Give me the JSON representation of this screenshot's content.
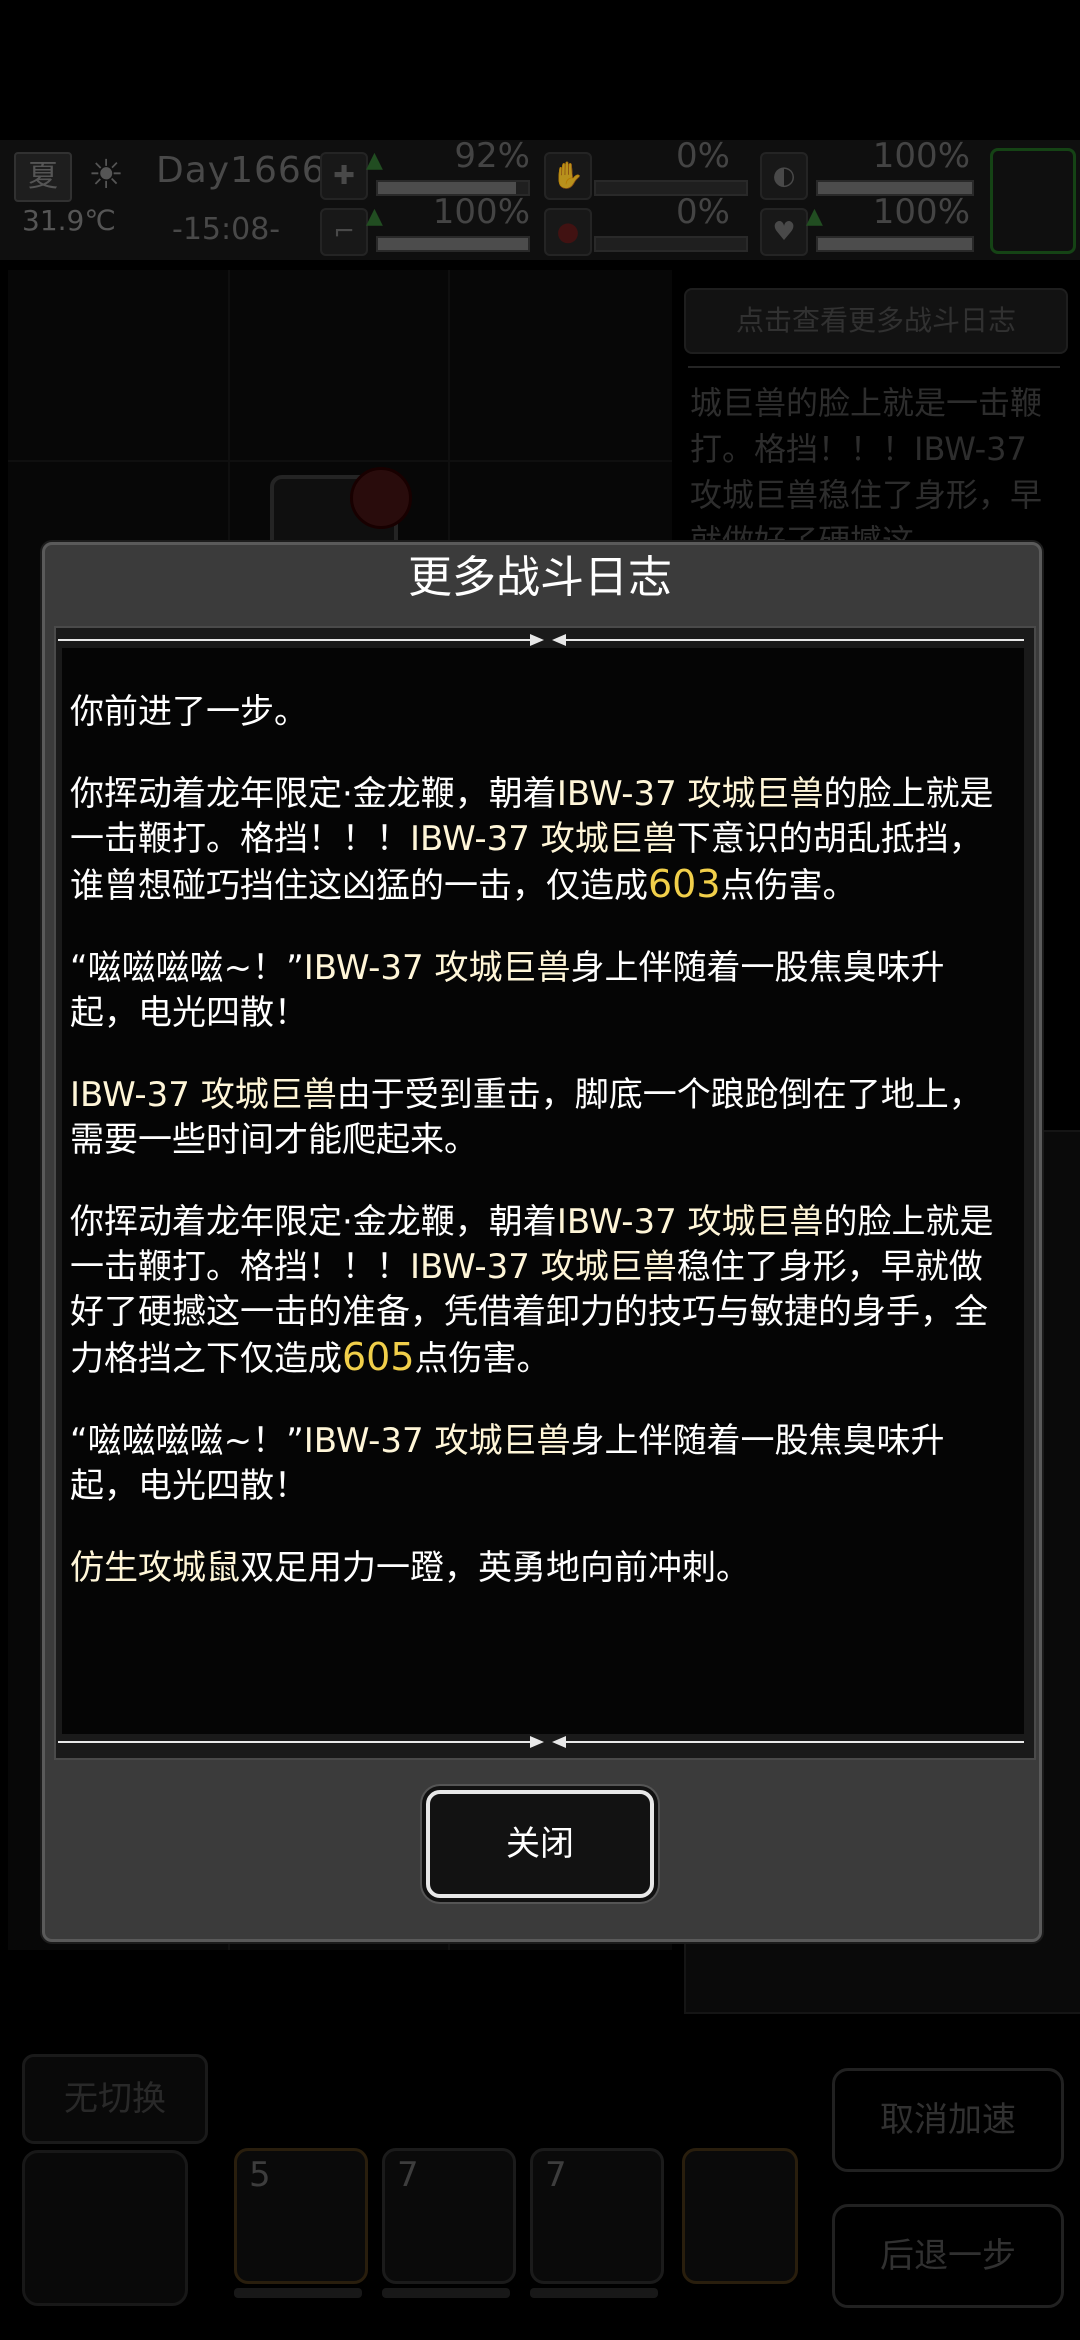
{
  "status": {
    "season": "夏",
    "temperature": "31.9℃",
    "day": "Day1666",
    "time": "-15:08-",
    "stats": [
      {
        "icon": "medkit-icon",
        "value": "92%",
        "level": 0.92
      },
      {
        "icon": "boot-icon",
        "value": "100%",
        "level": 1.0
      },
      {
        "icon": "blood-icon",
        "value": "0%",
        "level": 0.0
      },
      {
        "icon": "blood-drop-icon",
        "value": "0%",
        "level": 0.0
      },
      {
        "icon": "stomach-icon",
        "value": "100%",
        "level": 1.0
      },
      {
        "icon": "heart-icon",
        "value": "100%",
        "level": 1.0
      }
    ]
  },
  "side_log": {
    "button_label": "点击查看更多战斗日志",
    "preview": "城巨兽的脸上就是一击鞭打。格挡！！！IBW-37 攻城巨兽稳住了身形，早就做好了硬撼这"
  },
  "controls": {
    "switch_label": "无切换",
    "cancel_speed_label": "取消加速",
    "step_back_label": "后退一步",
    "skills": [
      {
        "count": "5"
      },
      {
        "count": "7"
      },
      {
        "count": "7"
      }
    ]
  },
  "dialog": {
    "title": "更多战斗日志",
    "close_label": "关闭",
    "entries": [
      {
        "parts": [
          {
            "t": "你前进了一步。",
            "s": "plain"
          }
        ]
      },
      {
        "parts": [
          {
            "t": "你挥动着龙年限定·金龙鞭，朝着",
            "s": "plain"
          },
          {
            "t": "IBW-37 攻城巨兽",
            "s": "hl"
          },
          {
            "t": "的脸上就是一击鞭打。格挡！！！",
            "s": "plain"
          },
          {
            "t": "IBW-37 攻城巨兽",
            "s": "hl"
          },
          {
            "t": "下意识的胡乱抵挡，谁曾想碰巧挡住这凶猛的一击，仅造成",
            "s": "plain"
          },
          {
            "t": "603",
            "s": "dmg"
          },
          {
            "t": "点伤害。",
            "s": "plain"
          }
        ]
      },
      {
        "parts": [
          {
            "t": "“嗞嗞嗞嗞~！”",
            "s": "plain"
          },
          {
            "t": "IBW-37 攻城巨兽",
            "s": "hl"
          },
          {
            "t": "身上伴随着一股焦臭味升起，电光四散！",
            "s": "plain"
          }
        ]
      },
      {
        "parts": [
          {
            "t": "IBW-37 攻城巨兽",
            "s": "hl"
          },
          {
            "t": "由于受到重击，脚底一个踉跄倒在了地上，需要一些时间才能爬起来。",
            "s": "plain"
          }
        ]
      },
      {
        "parts": [
          {
            "t": "你挥动着龙年限定·金龙鞭，朝着",
            "s": "plain"
          },
          {
            "t": "IBW-37 攻城巨兽",
            "s": "hl"
          },
          {
            "t": "的脸上就是一击鞭打。格挡！！！",
            "s": "plain"
          },
          {
            "t": "IBW-37 攻城巨兽",
            "s": "hl"
          },
          {
            "t": "稳住了身形，早就做好了硬撼这一击的准备，凭借着卸力的技巧与敏捷的身手，全力格挡之下仅造成",
            "s": "plain"
          },
          {
            "t": "605",
            "s": "dmg"
          },
          {
            "t": "点伤害。",
            "s": "plain"
          }
        ]
      },
      {
        "parts": [
          {
            "t": "“嗞嗞嗞嗞~！”",
            "s": "plain"
          },
          {
            "t": "IBW-37 攻城巨兽",
            "s": "hl"
          },
          {
            "t": "身上伴随着一股焦臭味升起，电光四散！",
            "s": "plain"
          }
        ]
      },
      {
        "parts": [
          {
            "t": "仿生攻城鼠",
            "s": "hl"
          },
          {
            "t": "双足用力一蹬，英勇地向前冲刺。",
            "s": "plain"
          }
        ]
      }
    ]
  },
  "colors": {
    "damage": "#f1cf4a",
    "name_highlight": "#fff6d8",
    "dialog_bg": "#3b3b3b"
  }
}
